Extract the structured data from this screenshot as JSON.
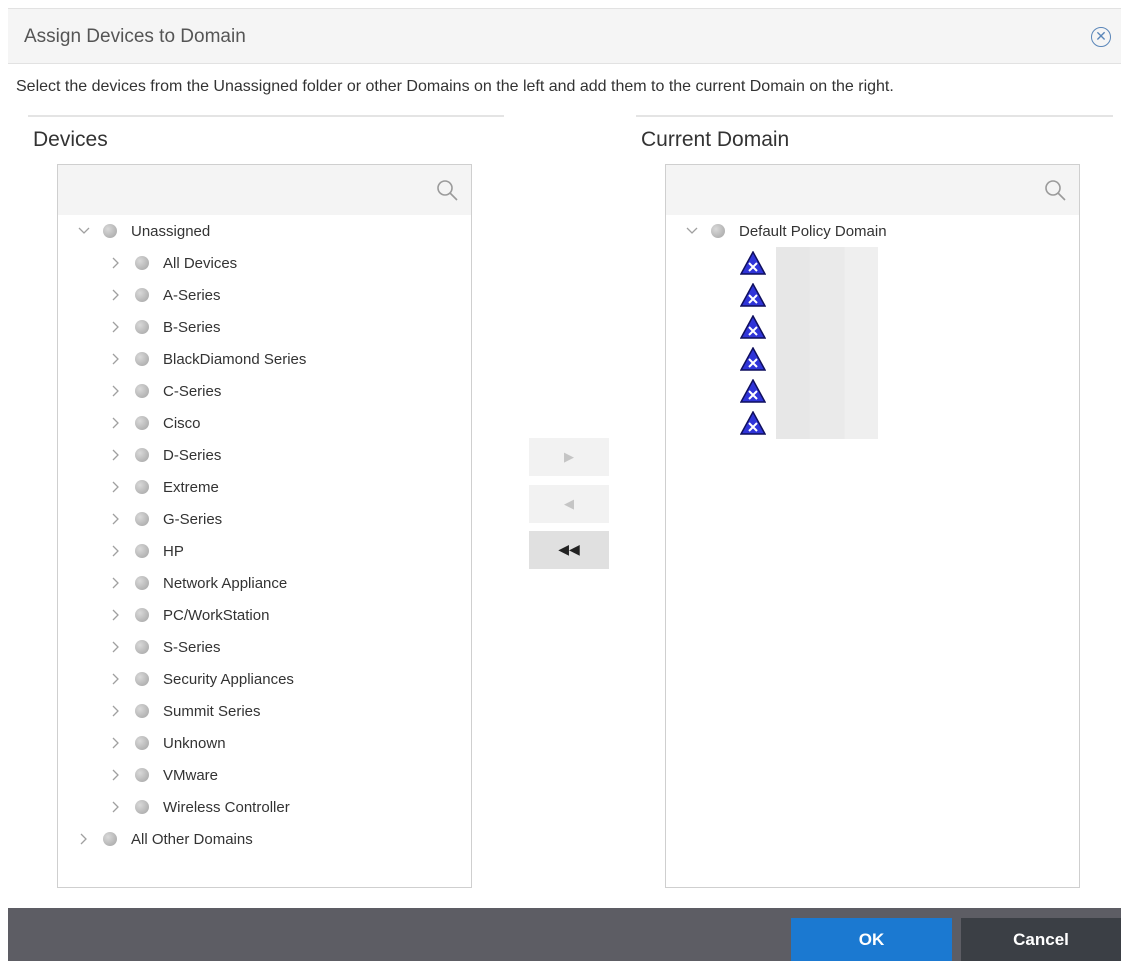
{
  "dialog": {
    "title": "Assign Devices to Domain",
    "close_icon": "close-circle-icon",
    "instructions": "Select the devices from the Unassigned folder or other Domains on the left and add them to the current Domain on the right."
  },
  "devices_panel": {
    "label": "Devices",
    "search_placeholder": "",
    "root": {
      "label": "Unassigned",
      "expanded": true
    },
    "children": [
      "All Devices",
      "A-Series",
      "B-Series",
      "BlackDiamond Series",
      "C-Series",
      "Cisco",
      "D-Series",
      "Extreme",
      "G-Series",
      "HP",
      "Network Appliance",
      "PC/WorkStation",
      "S-Series",
      "Security Appliances",
      "Summit Series",
      "Unknown",
      "VMware",
      "Wireless Controller"
    ],
    "other": {
      "label": "All Other Domains",
      "expanded": false
    }
  },
  "domain_panel": {
    "label": "Current Domain",
    "search_placeholder": "",
    "root": {
      "label": "Default Policy Domain",
      "expanded": true
    },
    "device_count": 6,
    "device_icon": "device-warning-icon"
  },
  "transfer": {
    "add_glyph": "▶",
    "remove_glyph": "◀",
    "remove_all_glyph": "◀◀"
  },
  "footer": {
    "ok_label": "OK",
    "cancel_label": "Cancel"
  },
  "colors": {
    "primary_button": "#1b79d1",
    "secondary_button": "#3b3f45",
    "footer_bar": "#5d5d64",
    "device_icon_fill": "#2f34d8"
  }
}
